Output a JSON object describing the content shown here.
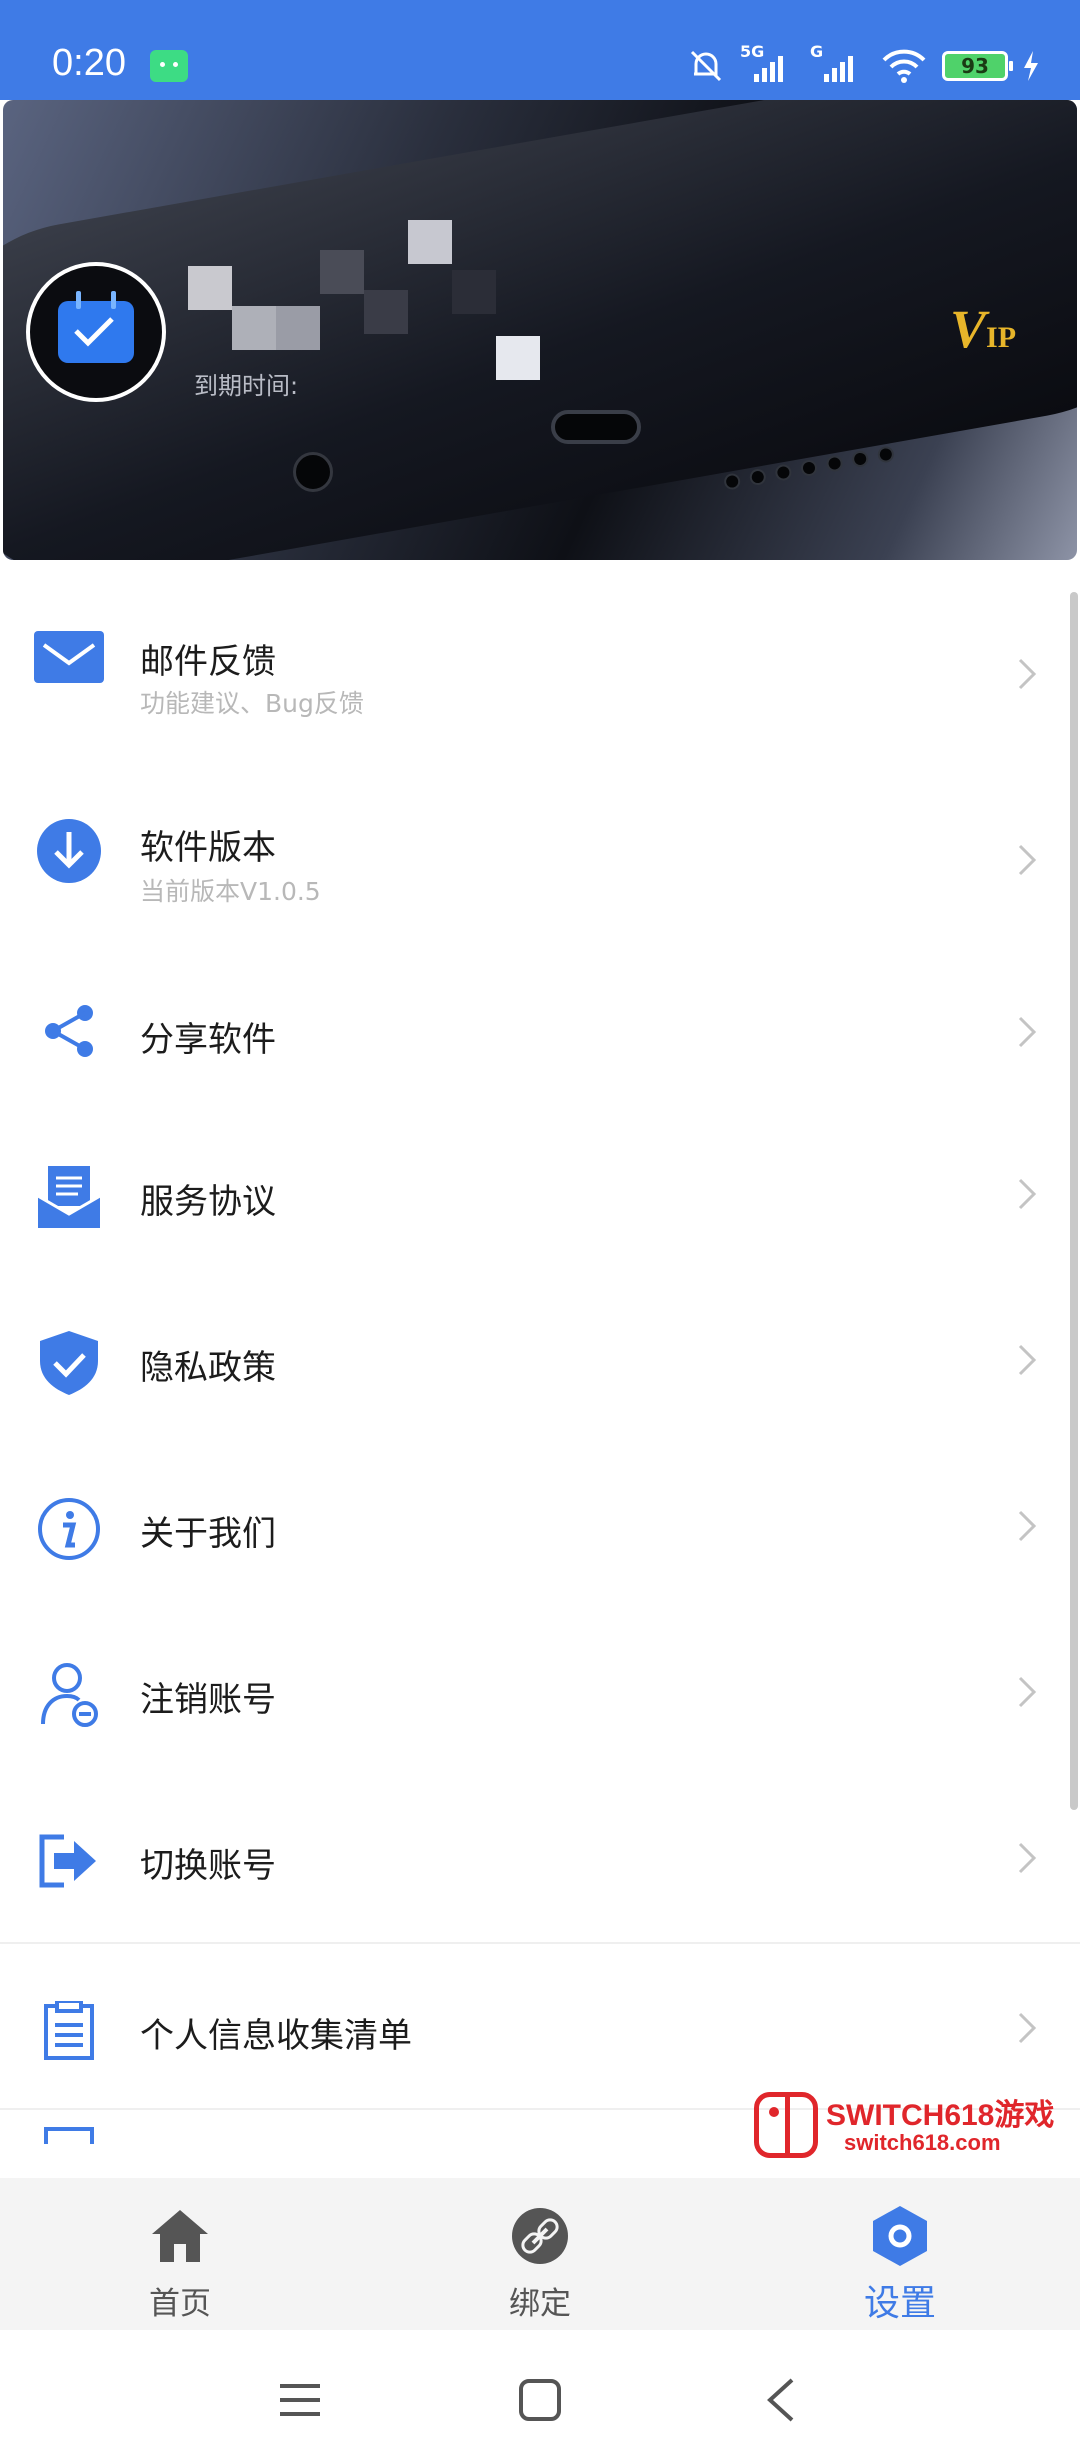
{
  "status_bar": {
    "time": "0:20",
    "network_5g": "5G",
    "network_g": "G",
    "battery": "93"
  },
  "header": {
    "expire_label": "到期时间:",
    "vip_v": "V",
    "vip_ip": "IP"
  },
  "menu": [
    {
      "title": "邮件反馈",
      "subtitle": "功能建议、Bug反馈",
      "icon": "mail-icon"
    },
    {
      "title": "软件版本",
      "subtitle": "当前版本V1.0.5",
      "icon": "download-icon"
    },
    {
      "title": "分享软件",
      "icon": "share-icon"
    },
    {
      "title": "服务协议",
      "icon": "agreement-icon"
    },
    {
      "title": "隐私政策",
      "icon": "shield-check-icon"
    },
    {
      "title": "关于我们",
      "icon": "info-icon"
    },
    {
      "title": "注销账号",
      "icon": "user-remove-icon"
    },
    {
      "title": "切换账号",
      "icon": "switch-account-icon"
    },
    {
      "title": "个人信息收集清单",
      "icon": "checklist-icon"
    }
  ],
  "watermark": {
    "title": "SWITCH618游戏",
    "url": "switch618.com"
  },
  "tabs": [
    {
      "label": "首页",
      "icon": "home-icon"
    },
    {
      "label": "绑定",
      "icon": "link-icon"
    },
    {
      "label": "设置",
      "icon": "settings-icon",
      "active": true
    }
  ],
  "colors": {
    "accent": "#3f7be6",
    "vip": "#e7b52a"
  }
}
